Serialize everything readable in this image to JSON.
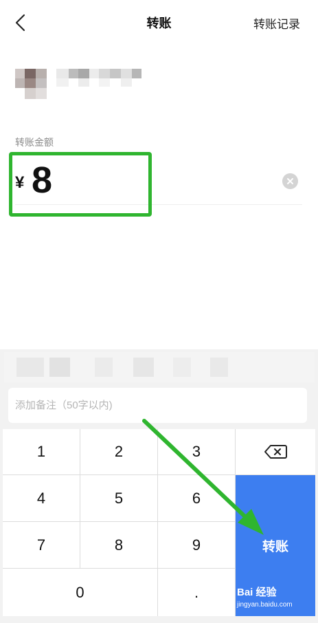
{
  "header": {
    "title": "转账",
    "history_label": "转账记录",
    "back_icon": "chevron-left-icon"
  },
  "amount": {
    "label": "转账金额",
    "currency": "¥",
    "value": "8"
  },
  "note": {
    "placeholder": "添加备注（50字以内)"
  },
  "keypad": {
    "digits": [
      "1",
      "2",
      "3",
      "4",
      "5",
      "6",
      "7",
      "8",
      "9",
      "0"
    ],
    "decimal": ".",
    "backspace_icon": "backspace-icon",
    "transfer_label": "转账"
  },
  "watermark": {
    "brand": "Bai 经验",
    "url": "jingyan.baidu.com"
  },
  "colors": {
    "accent": "#3d7ef0",
    "highlight": "#2fb52f",
    "arrow": "#2fb52f"
  }
}
